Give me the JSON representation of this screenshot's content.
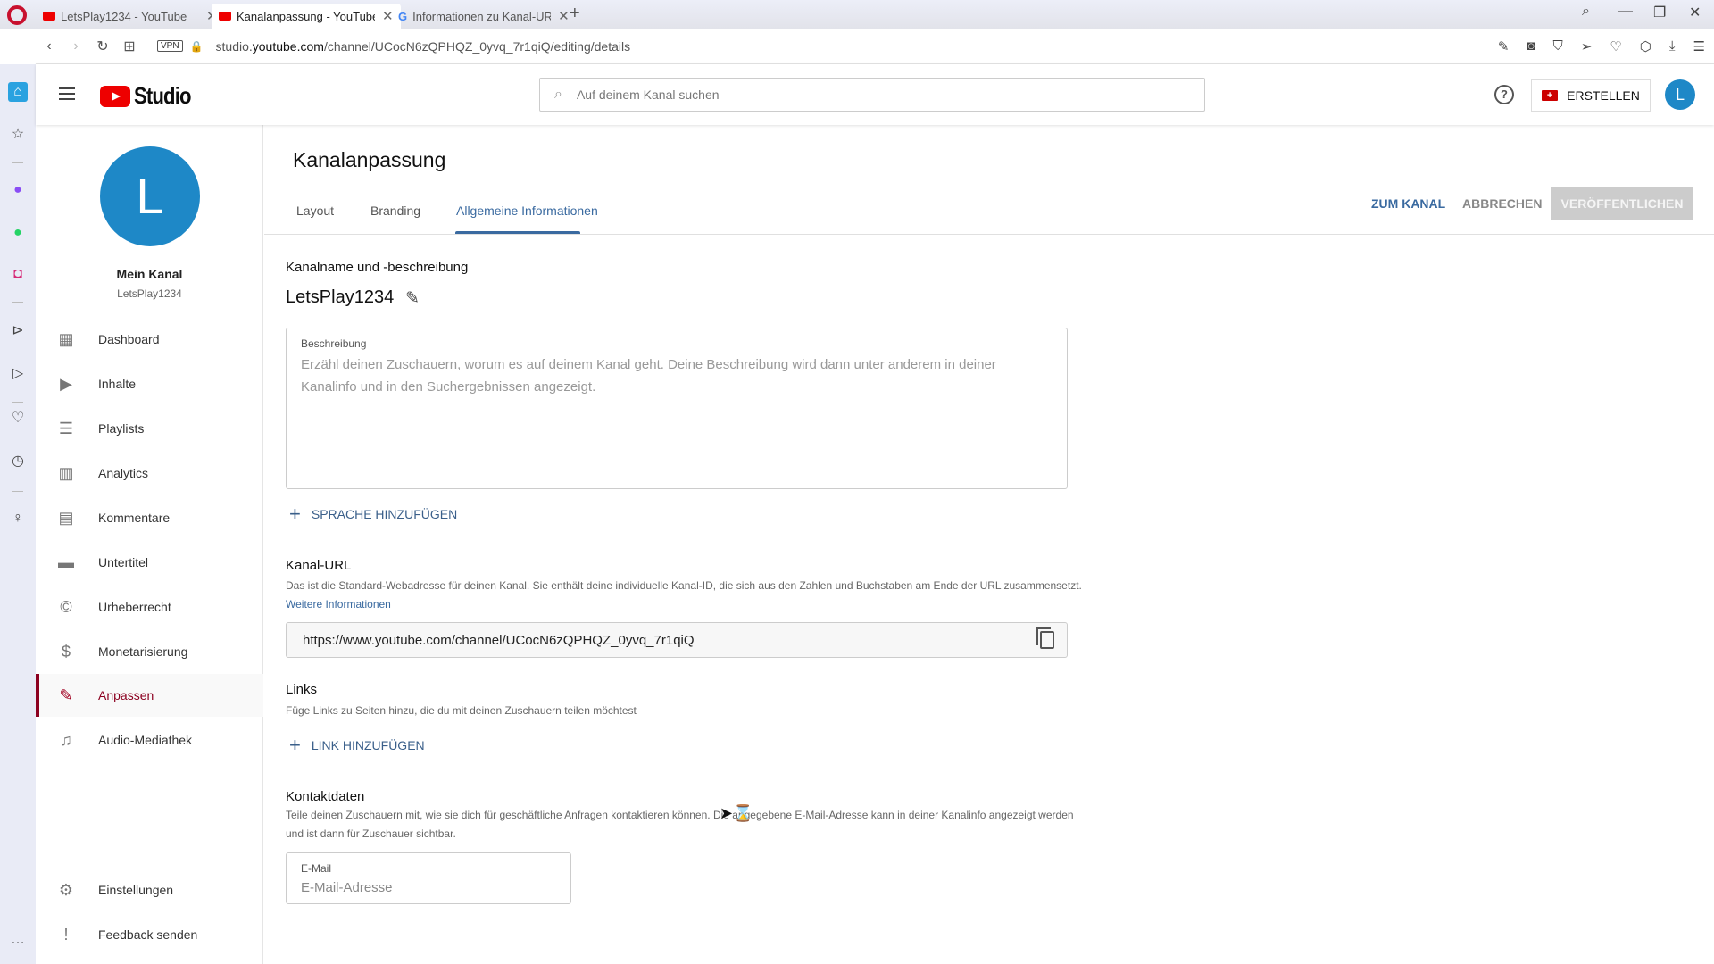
{
  "browser": {
    "tabs": [
      {
        "label": "LetsPlay1234 - YouTube",
        "favicon": "youtube-icon",
        "active": false
      },
      {
        "label": "Kanalanpassung - YouTube",
        "favicon": "youtube-icon",
        "active": true
      },
      {
        "label": "Informationen zu Kanal-UR",
        "favicon": "google-icon",
        "active": false
      }
    ],
    "new_tab": "+",
    "address": {
      "prefix": "studio.",
      "domain": "youtube.com",
      "path": "/channel/UCocN6zQPHQZ_0yvq_7r1qiQ/editing/details"
    },
    "vpn_label": "VPN"
  },
  "header": {
    "logo_text": "Studio",
    "search_placeholder": "Auf deinem Kanal suchen",
    "help": "?",
    "create_label": "ERSTELLEN",
    "avatar_letter": "L"
  },
  "sidebar": {
    "avatar_letter": "L",
    "channel_title": "Mein Kanal",
    "channel_handle": "LetsPlay1234",
    "items": [
      {
        "label": "Dashboard",
        "icon": "dashboard-icon",
        "glyph": "▦"
      },
      {
        "label": "Inhalte",
        "icon": "content-icon",
        "glyph": "▶"
      },
      {
        "label": "Playlists",
        "icon": "playlists-icon",
        "glyph": "☰"
      },
      {
        "label": "Analytics",
        "icon": "analytics-icon",
        "glyph": "▥"
      },
      {
        "label": "Kommentare",
        "icon": "comments-icon",
        "glyph": "▤"
      },
      {
        "label": "Untertitel",
        "icon": "subtitles-icon",
        "glyph": "▬"
      },
      {
        "label": "Urheberrecht",
        "icon": "copyright-icon",
        "glyph": "©"
      },
      {
        "label": "Monetarisierung",
        "icon": "dollar-icon",
        "glyph": "$"
      },
      {
        "label": "Anpassen",
        "icon": "magic-wand-icon",
        "glyph": "✎",
        "active": true
      },
      {
        "label": "Audio-Mediathek",
        "icon": "audio-library-icon",
        "glyph": "♫"
      }
    ],
    "bottom_items": [
      {
        "label": "Einstellungen",
        "icon": "gear-icon",
        "glyph": "⚙"
      },
      {
        "label": "Feedback senden",
        "icon": "feedback-icon",
        "glyph": "!"
      }
    ]
  },
  "main": {
    "title": "Kanalanpassung",
    "tabs": [
      {
        "label": "Layout"
      },
      {
        "label": "Branding"
      },
      {
        "label": "Allgemeine Informationen",
        "active": true
      }
    ],
    "actions": {
      "view_channel": "ZUM KANAL",
      "cancel": "ABBRECHEN",
      "publish": "VERÖFFENTLICHEN"
    },
    "name_section": {
      "heading": "Kanalname und -beschreibung",
      "channel_name": "LetsPlay1234",
      "description_label": "Beschreibung",
      "description_placeholder": "Erzähl deinen Zuschauern, worum es auf deinem Kanal geht. Deine Beschreibung wird dann unter anderem in deiner Kanalinfo und in den Suchergebnissen angezeigt.",
      "description_value": "",
      "add_language": "SPRACHE HINZUFÜGEN"
    },
    "url_section": {
      "heading": "Kanal-URL",
      "help": "Das ist die Standard-Webadresse für deinen Kanal. Sie enthält deine individuelle Kanal-ID, die sich aus den Zahlen und Buchstaben am Ende der URL zusammensetzt.",
      "more_info": "Weitere Informationen",
      "url": "https://www.youtube.com/channel/UCocN6zQPHQZ_0yvq_7r1qiQ"
    },
    "links_section": {
      "heading": "Links",
      "help": "Füge Links zu Seiten hinzu, die du mit deinen Zuschauern teilen möchtest",
      "add_link": "LINK HINZUFÜGEN"
    },
    "contact_section": {
      "heading": "Kontaktdaten",
      "help": "Teile deinen Zuschauern mit, wie sie dich für geschäftliche Anfragen kontaktieren können. Die angegebene E-Mail-Adresse kann in deiner Kanalinfo angezeigt werden und ist dann für Zuschauer sichtbar.",
      "email_label": "E-Mail",
      "email_placeholder": "E-Mail-Adresse",
      "email_value": ""
    }
  },
  "colors": {
    "accent_blue": "#3a6aa0",
    "active_red": "#8c0020",
    "avatar_blue": "#1e88c7",
    "youtube_red": "#ee0000"
  }
}
